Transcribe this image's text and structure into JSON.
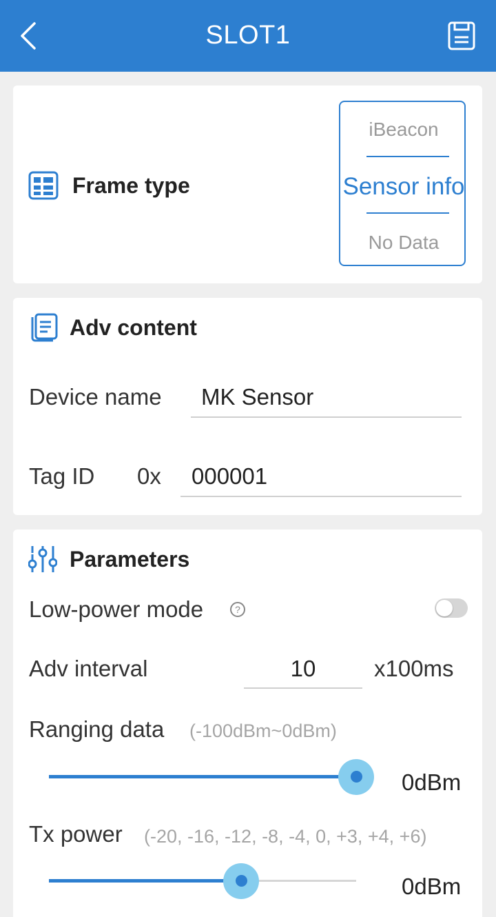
{
  "header": {
    "title": "SLOT1"
  },
  "frame_type": {
    "label": "Frame type",
    "options_visible": [
      "iBeacon",
      "Sensor info",
      "No Data"
    ],
    "selected": "Sensor info"
  },
  "adv_content": {
    "label": "Adv content",
    "device_name_label": "Device name",
    "device_name_value": "MK Sensor",
    "tag_id_label": "Tag ID",
    "tag_id_prefix": "0x",
    "tag_id_value": "000001"
  },
  "parameters": {
    "label": "Parameters",
    "low_power_label": "Low-power mode",
    "low_power_enabled": false,
    "adv_interval_label": "Adv interval",
    "adv_interval_value": "10",
    "adv_interval_unit": "x100ms",
    "ranging_label": "Ranging data",
    "ranging_hint": "(-100dBm~0dBm)",
    "ranging_value": "0dBm",
    "ranging_fraction": 1.0,
    "tx_power_label": "Tx power",
    "tx_power_hint": "(-20, -16, -12, -8, -4, 0, +3, +4, +6)",
    "tx_power_value": "0dBm",
    "tx_power_fraction": 0.625
  },
  "colors": {
    "primary": "#2d7fd0",
    "background": "#efefef",
    "slider_halo": "#86cdee"
  },
  "icons": [
    "back-arrow-icon",
    "save-icon",
    "frame-type-icon",
    "adv-content-icon",
    "parameters-icon",
    "help-icon"
  ]
}
